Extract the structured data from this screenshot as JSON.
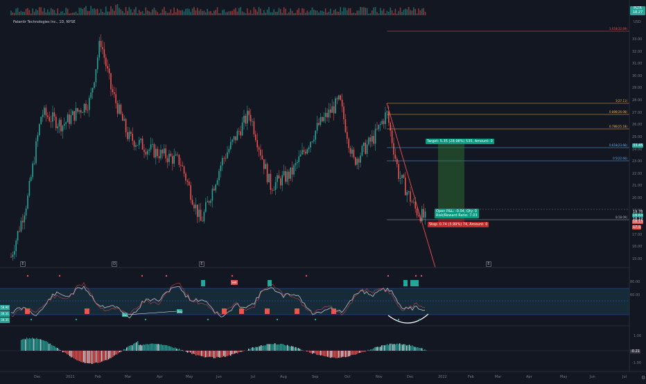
{
  "chart": {
    "title": "Palantir Technologies Inc., 1D, NYSE",
    "currency": "USD",
    "header_price": {
      "symbol": "PLTR",
      "value": "18.27"
    },
    "colors": {
      "up": "#26a69a",
      "down": "#ef5350",
      "background": "#131722",
      "fib": "#ffb74d",
      "fib_blue": "#64b5f6",
      "target": "#2e7d32",
      "stop": "#c62828"
    }
  },
  "price_axis": [
    "33.00",
    "32.00",
    "31.00",
    "30.00",
    "29.00",
    "28.00",
    "27.00",
    "26.00",
    "25.00",
    "24.00",
    "23.00",
    "22.00",
    "21.00",
    "20.00",
    "19.00",
    "18.00",
    "17.00",
    "16.00",
    "15.00"
  ],
  "price_tags": [
    {
      "label": "33.45",
      "color": "#26a69a"
    },
    {
      "label": "19.78",
      "color": "#131722"
    },
    {
      "label": "18.63",
      "color": "#26a69a"
    },
    {
      "label": "18.19",
      "color": "#131722"
    },
    {
      "label": "18.13",
      "color": "#ef5350"
    },
    {
      "label": "17.5",
      "color": "#ef5350"
    }
  ],
  "fib_levels": [
    {
      "label": "1.618(32.69)",
      "color": "#ef5350"
    },
    {
      "label": "1(27.11)",
      "color": "#ffb74d"
    },
    {
      "label": "0.886(26.08)",
      "color": "#ffb74d"
    },
    {
      "label": "0.786(25.18)",
      "color": "#ffb74d"
    },
    {
      "label": "0.618(23.66)",
      "color": "#64b5f6"
    },
    {
      "label": "0.5(22.60)",
      "color": "#64b5f6"
    },
    {
      "label": "0(18.09)",
      "color": "#b2b5be"
    }
  ],
  "callouts": {
    "target": "Target: 5.35 (28.98%) 535, Amount: 0",
    "open_pl_line1": "Open P&L: -0.04, Qty: 0",
    "open_pl_line2": "Risk/Reward Ratio: 7.03",
    "stop": "Stop: 0.74 (3.99%) 74, Amount: 0"
  },
  "osc_axis": [
    "80.00",
    "60.00"
  ],
  "osc_left": [
    {
      "label": "58.90",
      "color": "#26a69a"
    },
    {
      "label": "36.31",
      "color": "#26a69a"
    },
    {
      "label": "30.35",
      "color": "#26a69a"
    }
  ],
  "osc_labels": {
    "sell": "Sell",
    "buy1": "Buy",
    "buy2": "Buy"
  },
  "macd_axis": [
    "1.00",
    "-1.00"
  ],
  "macd_tag": "-0.21",
  "months": [
    "Dec",
    "2021",
    "Feb",
    "Mar",
    "Apr",
    "May",
    "Jun",
    "Jul",
    "Aug",
    "Sep",
    "Oct",
    "Nov",
    "Dec",
    "2022",
    "Feb",
    "Mar",
    "Apr",
    "May",
    "Jun",
    "Jul"
  ],
  "events": [
    "E",
    "D",
    "E",
    "E"
  ]
}
